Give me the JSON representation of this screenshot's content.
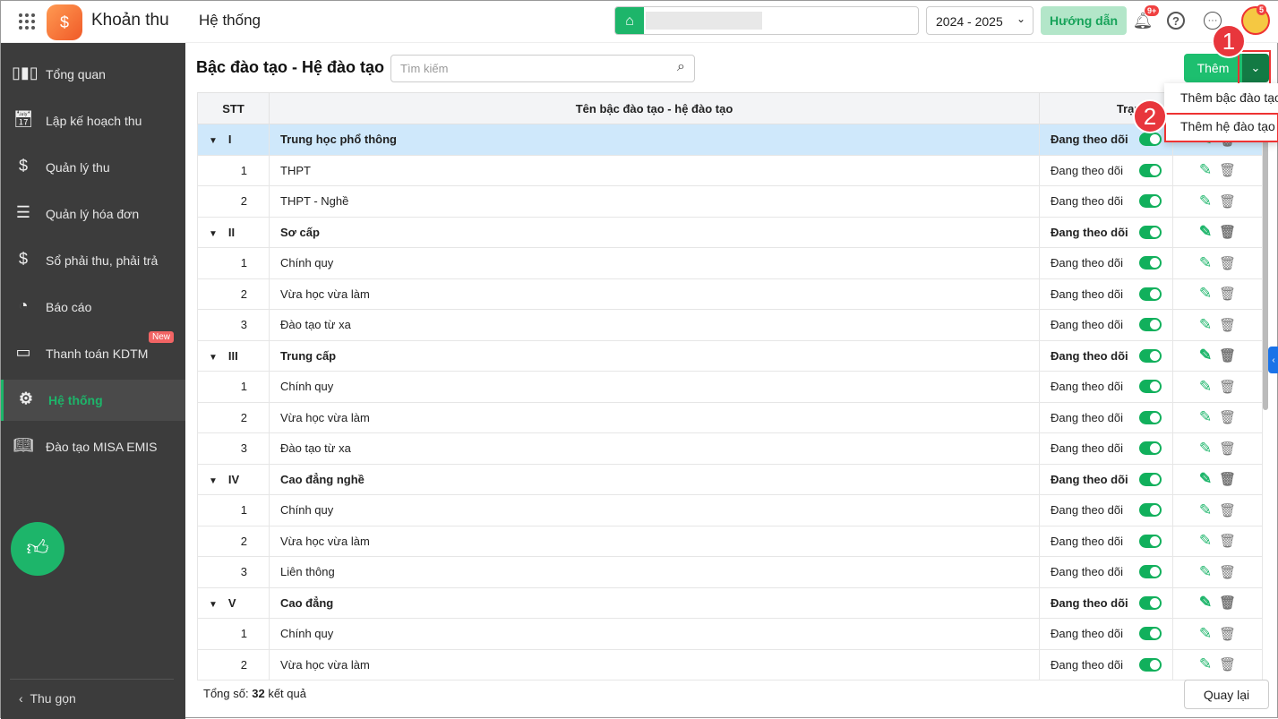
{
  "header": {
    "app_name": "Khoản thu",
    "module": "Hệ thống",
    "school_year": "2024 - 2025",
    "guide_label": "Hướng dẫn",
    "notif_badge": "9+",
    "avatar_badge": "5"
  },
  "sidebar": {
    "items": [
      {
        "label": "Tổng quan",
        "icon": "chart-icon"
      },
      {
        "label": "Lập kế hoạch thu",
        "icon": "calendar-dollar-icon"
      },
      {
        "label": "Quản lý thu",
        "icon": "money-hand-icon"
      },
      {
        "label": "Quản lý hóa đơn",
        "icon": "invoice-icon"
      },
      {
        "label": "Sổ phải thu, phải trả",
        "icon": "ledger-icon"
      },
      {
        "label": "Báo cáo",
        "icon": "pie-chart-icon"
      },
      {
        "label": "Thanh toán KDTM",
        "icon": "card-check-icon",
        "badge": "New"
      },
      {
        "label": "Hệ thống",
        "icon": "gear-icon",
        "active": true
      },
      {
        "label": "Đào tạo MISA EMIS",
        "icon": "book-icon"
      }
    ],
    "collapse_label": "Thu gọn"
  },
  "page": {
    "title": "Bậc đào tạo - Hệ đào tạo",
    "search_placeholder": "Tìm kiếm",
    "add_label": "Thêm",
    "menu": [
      "Thêm bậc đào tạo",
      "Thêm hệ đào tạo"
    ],
    "steps": [
      "1",
      "2"
    ],
    "columns": [
      "STT",
      "Tên bậc đào tạo - hệ đào tạo",
      "Trạng thái"
    ],
    "rows": [
      {
        "stt": "I",
        "name": "Trung học phổ thông",
        "group": true,
        "status": "Đang theo dõi",
        "on": true
      },
      {
        "stt": "1",
        "name": "THPT",
        "status": "Đang theo dõi",
        "on": true
      },
      {
        "stt": "2",
        "name": "THPT - Nghề",
        "status": "Đang theo dõi",
        "on": true
      },
      {
        "stt": "II",
        "name": "Sơ cấp",
        "group": true,
        "status": "Đang theo dõi",
        "on": true
      },
      {
        "stt": "1",
        "name": "Chính quy",
        "status": "Đang theo dõi",
        "on": true
      },
      {
        "stt": "2",
        "name": "Vừa học vừa làm",
        "status": "Đang theo dõi",
        "on": true
      },
      {
        "stt": "3",
        "name": "Đào tạo từ xa",
        "status": "Đang theo dõi",
        "on": true
      },
      {
        "stt": "III",
        "name": "Trung cấp",
        "group": true,
        "status": "Đang theo dõi",
        "on": true
      },
      {
        "stt": "1",
        "name": "Chính quy",
        "status": "Đang theo dõi",
        "on": true
      },
      {
        "stt": "2",
        "name": "Vừa học vừa làm",
        "status": "Đang theo dõi",
        "on": true
      },
      {
        "stt": "3",
        "name": "Đào tạo từ xa",
        "status": "Đang theo dõi",
        "on": true
      },
      {
        "stt": "IV",
        "name": "Cao đẳng nghề",
        "group": true,
        "status": "Đang theo dõi",
        "on": true
      },
      {
        "stt": "1",
        "name": "Chính quy",
        "status": "Đang theo dõi",
        "on": true
      },
      {
        "stt": "2",
        "name": "Vừa học vừa làm",
        "status": "Đang theo dõi",
        "on": true
      },
      {
        "stt": "3",
        "name": "Liên thông",
        "status": "Đang theo dõi",
        "on": true
      },
      {
        "stt": "V",
        "name": "Cao đẳng",
        "group": true,
        "status": "Đang theo dõi",
        "on": true
      },
      {
        "stt": "1",
        "name": "Chính quy",
        "status": "Đang theo dõi",
        "on": true
      },
      {
        "stt": "2",
        "name": "Vừa học vừa làm",
        "status": "Đang theo dõi",
        "on": true
      }
    ],
    "total_prefix": "Tổng số:",
    "total": "32",
    "total_suffix": "kết quả",
    "back_label": "Quay lại"
  },
  "colors": {
    "accent": "#1db56a",
    "sidebar": "#3c3c3c",
    "selected_row": "#cfe8fb",
    "highlight": "#e8363c"
  }
}
